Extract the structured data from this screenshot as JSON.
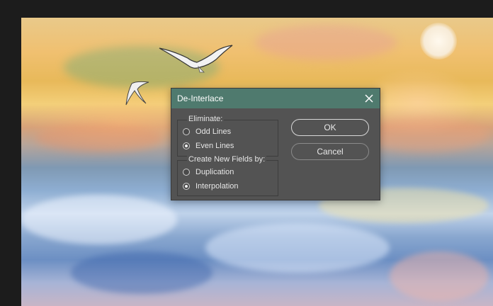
{
  "dialog": {
    "title": "De-Interlace",
    "close_icon": "close-icon",
    "eliminate": {
      "legend": "Eliminate:",
      "options": [
        {
          "label": "Odd Lines",
          "checked": false
        },
        {
          "label": "Even Lines",
          "checked": true
        }
      ]
    },
    "create_fields": {
      "legend": "Create New Fields by:",
      "options": [
        {
          "label": "Duplication",
          "checked": false
        },
        {
          "label": "Interpolation",
          "checked": true
        }
      ]
    },
    "ok_label": "OK",
    "cancel_label": "Cancel"
  },
  "colors": {
    "titlebar": "#4f7a6e",
    "dialog_bg": "#535353",
    "app_bg": "#1c1c1c"
  }
}
